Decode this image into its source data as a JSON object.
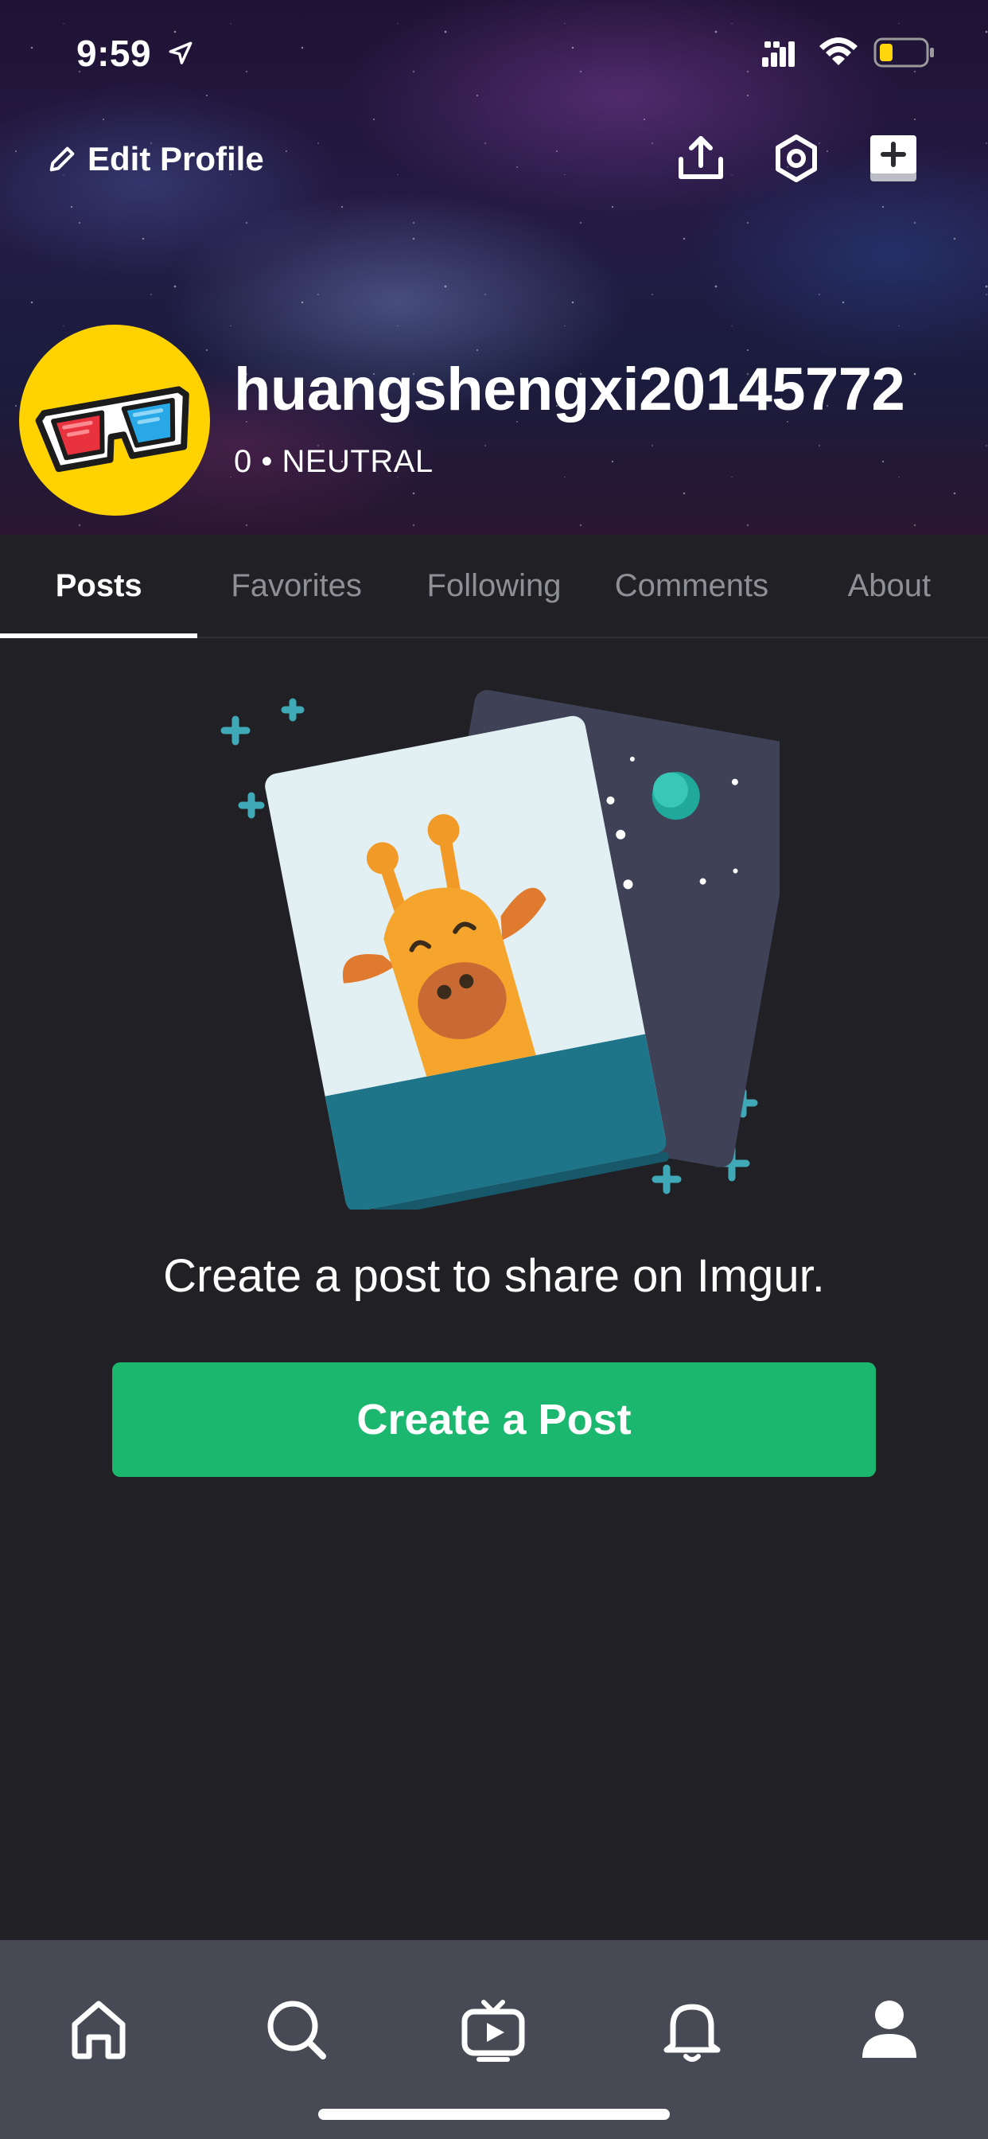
{
  "status_bar": {
    "time": "9:59",
    "battery_color": "#ffd60a"
  },
  "header": {
    "edit_profile_label": "Edit Profile",
    "icons": [
      "upload-icon",
      "settings-icon",
      "new-post-icon"
    ]
  },
  "profile": {
    "username": "huangshengxi20145772",
    "reputation": "0 • NEUTRAL",
    "avatar_icon": "3d-glasses-icon",
    "avatar_color": "#ffd200"
  },
  "tabs": [
    {
      "label": "Posts",
      "active": true
    },
    {
      "label": "Favorites",
      "active": false
    },
    {
      "label": "Following",
      "active": false
    },
    {
      "label": "Comments",
      "active": false
    },
    {
      "label": "About",
      "active": false
    }
  ],
  "empty_state": {
    "message": "Create a post to share on Imgur.",
    "button_label": "Create a Post",
    "button_color": "#1bb76e"
  },
  "bottom_nav": {
    "items": [
      "home-icon",
      "search-icon",
      "video-icon",
      "bell-icon",
      "profile-icon"
    ],
    "active": "profile-icon"
  }
}
